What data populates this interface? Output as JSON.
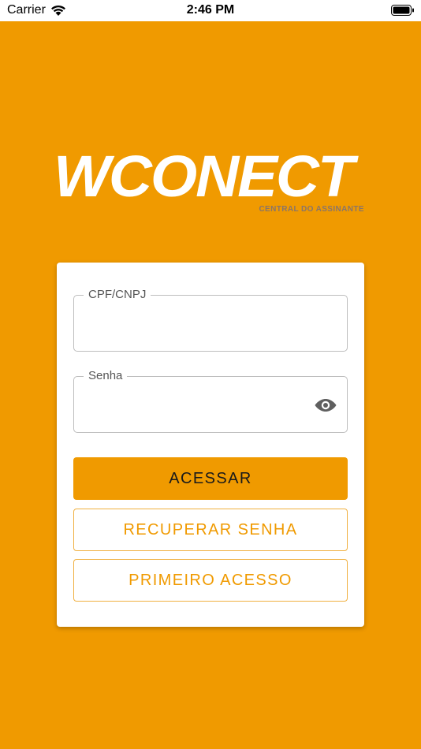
{
  "status_bar": {
    "carrier": "Carrier",
    "time": "2:46 PM",
    "wifi_icon": "wifi-icon",
    "battery_icon": "battery-icon"
  },
  "logo": {
    "brand": "WCONECT",
    "tagline": "CENTRAL DO ASSINANTE"
  },
  "login": {
    "cpf_label": "CPF/CNPJ",
    "cpf_value": "",
    "password_label": "Senha",
    "password_value": "",
    "password_toggle_icon": "eye-icon",
    "access_button": "ACESSAR",
    "recover_button": "RECUPERAR SENHA",
    "first_access_button": "PRIMEIRO ACESSO"
  },
  "colors": {
    "background": "#F09A00",
    "card": "#FFFFFF",
    "primary_button": "#F09A00",
    "outline_button_text": "#F09A00",
    "tagline": "#8A7568"
  }
}
